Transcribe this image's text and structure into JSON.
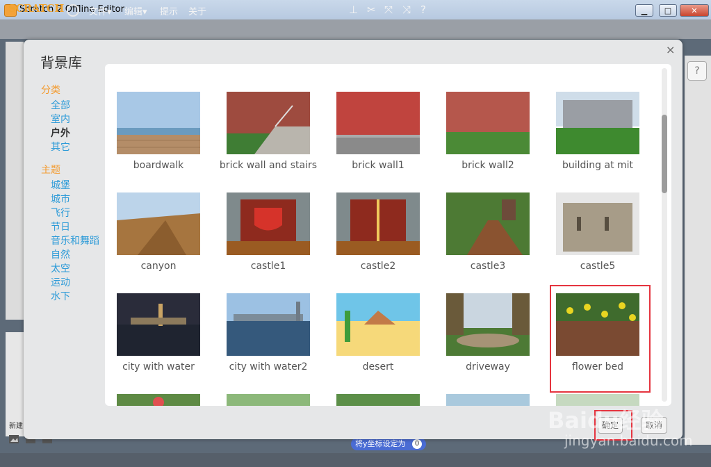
{
  "window": {
    "title": "Scratch 2 Offline Editor",
    "min": "▁",
    "max": "□",
    "close": "✕"
  },
  "menubar": {
    "logo": "SCRATCH",
    "items": [
      "文件▾",
      "编辑▾",
      "提示",
      "关于"
    ],
    "tool_icons": [
      "stamp-icon",
      "cut-icon",
      "grow-icon",
      "shrink-icon",
      "help-icon"
    ]
  },
  "dialog": {
    "title": "背景库",
    "close": "×",
    "category_heading": "分类",
    "categories": [
      "全部",
      "室内",
      "户外",
      "其它"
    ],
    "selected_category": "户外",
    "theme_heading": "主题",
    "themes": [
      "城堡",
      "城市",
      "飞行",
      "节日",
      "音乐和舞蹈",
      "自然",
      "太空",
      "运动",
      "水下"
    ],
    "ok_label": "确定",
    "cancel_label": "取消"
  },
  "library": {
    "rows": [
      [
        "boardwalk",
        "brick wall and stairs",
        "brick wall1",
        "brick wall2",
        "building at mit"
      ],
      [
        "canyon",
        "castle1",
        "castle2",
        "castle3",
        "castle5"
      ],
      [
        "city with water",
        "city with water2",
        "desert",
        "driveway",
        "flower bed"
      ]
    ],
    "selected": "flower bed"
  },
  "background": {
    "new_label": "新建",
    "help": "?",
    "block_text": "将y坐标设定为",
    "block_value": "0"
  },
  "watermark": {
    "main": "Baidu经验",
    "sub": "jingyan.baidu.com"
  },
  "colors": {
    "accent_orange": "#f39c32",
    "link_blue": "#2d9bd8",
    "highlight_red": "#e5343f"
  }
}
